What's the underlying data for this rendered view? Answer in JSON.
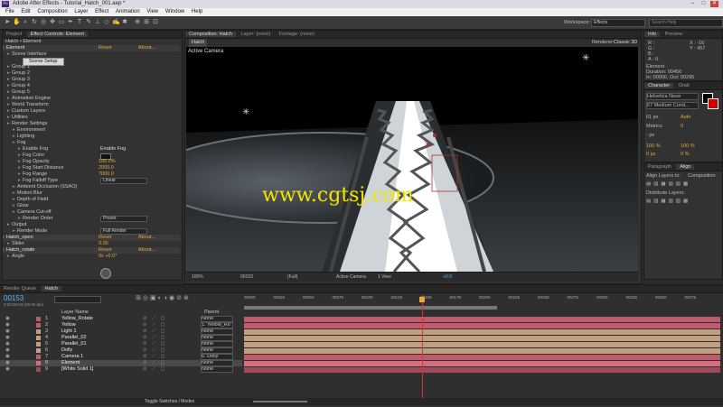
{
  "window": {
    "title": "Adobe After Effects - Tutorial_Hatch_001.aep *"
  },
  "menu": [
    "File",
    "Edit",
    "Composition",
    "Layer",
    "Effect",
    "Animation",
    "View",
    "Window",
    "Help"
  ],
  "workspace": {
    "label": "Workspace:",
    "value": "Effects",
    "search_placeholder": "Search Help"
  },
  "left_panel": {
    "tabs": [
      "Project",
      "Effect Controls: Element"
    ],
    "breadcrumb": "Hatch • Element",
    "rows": [
      {
        "indent": 0,
        "text": "Element",
        "value": "Reset",
        "extra": "About...",
        "kind": "header"
      },
      {
        "indent": 1,
        "text": "Scene Interface"
      },
      {
        "indent": 3,
        "text": "Scene Setup",
        "kind": "button"
      },
      {
        "indent": 1,
        "text": "Group 1"
      },
      {
        "indent": 1,
        "text": "Group 2"
      },
      {
        "indent": 1,
        "text": "Group 3"
      },
      {
        "indent": 1,
        "text": "Group 4"
      },
      {
        "indent": 1,
        "text": "Group 5"
      },
      {
        "indent": 1,
        "text": "Animation Engine"
      },
      {
        "indent": 1,
        "text": "World Transform"
      },
      {
        "indent": 1,
        "text": "Custom Layers"
      },
      {
        "indent": 1,
        "text": "Utilities"
      },
      {
        "indent": 1,
        "text": "Render Settings"
      },
      {
        "indent": 2,
        "text": "Environment"
      },
      {
        "indent": 2,
        "text": "Lighting"
      },
      {
        "indent": 2,
        "text": "Fog"
      },
      {
        "indent": 3,
        "text": "Enable Fog",
        "check": "Enable Fog"
      },
      {
        "indent": 3,
        "text": "Fog Color",
        "kind": "color"
      },
      {
        "indent": 3,
        "text": "Fog Opacity",
        "value": "100.0%"
      },
      {
        "indent": 3,
        "text": "Fog Start Distance",
        "value": "2000.0"
      },
      {
        "indent": 3,
        "text": "Fog Range",
        "value": "7000.0"
      },
      {
        "indent": 3,
        "text": "Fog Falloff Type",
        "dropdown": "Linear"
      },
      {
        "indent": 2,
        "text": "Ambient Occlusion (SSAO)"
      },
      {
        "indent": 2,
        "text": "Motion Blur"
      },
      {
        "indent": 2,
        "text": "Depth of Field"
      },
      {
        "indent": 2,
        "text": "Glow"
      },
      {
        "indent": 2,
        "text": "Camera Cut-off"
      },
      {
        "indent": 3,
        "text": "Render Order",
        "dropdown": "Preset"
      },
      {
        "indent": 1,
        "text": "Output"
      },
      {
        "indent": 2,
        "text": "Render Mode",
        "dropdown": "Full Render"
      },
      {
        "indent": 0,
        "text": "Hatch_open",
        "value": "Reset",
        "extra": "About...",
        "kind": "header"
      },
      {
        "indent": 1,
        "text": "Slider",
        "value": "0.00"
      },
      {
        "indent": 0,
        "text": "Hatch_rotate",
        "value": "Reset",
        "extra": "About...",
        "kind": "header"
      },
      {
        "indent": 1,
        "text": "Angle",
        "value": "0x +0.0°"
      }
    ]
  },
  "comp_panel": {
    "tabs": [
      "Composition: Hatch",
      "Layer: (none)",
      "Footage: (none)"
    ],
    "sub_tab": "Hatch",
    "renderer_label": "Renderer:",
    "renderer_value": "Classic 3D",
    "camera_label": "Active Camera",
    "watermark": "www.cgtsj.com",
    "bottom_bar": {
      "zoom": "100%",
      "timecode": "00153",
      "resolution": "(Full)",
      "view": "Active Camera",
      "views": "1 View",
      "exposure": "+0.0"
    }
  },
  "info_panel": {
    "tabs": [
      "Info",
      "Preview"
    ],
    "r": "R :",
    "g": "G :",
    "b": "B :",
    "a": "A : 0",
    "x": "X : -16",
    "y": "Y : 457",
    "layer_name": "Element",
    "duration": "Duration: 00456",
    "in_out": "In: 00000, Out: 00295"
  },
  "character_panel": {
    "tabs": [
      "Character",
      "Grab"
    ],
    "font": "Helvetica Neue",
    "style": "67 Medium Cond...",
    "size": "61 px",
    "leading": "Auto",
    "tracking_label": "Metrics",
    "tracking": "0",
    "stroke": "- px",
    "vscale": "100 %",
    "hscale": "100 %",
    "baseline": "0 px",
    "tsume": "0 %"
  },
  "align_panel": {
    "tabs": [
      "Paragraph",
      "Align"
    ],
    "align_label": "Align Layers to:",
    "align_value": "Composition",
    "distribute_label": "Distribute Layers:"
  },
  "timeline": {
    "tabs": [
      "Render Queue",
      "Hatch"
    ],
    "timecode": "00153",
    "sub_timecode": "0:00:06:03 (25.00 fps)",
    "search_placeholder": "",
    "col_layer": "Layer Name",
    "col_parent": "Parent",
    "ruler": [
      "00000",
      "00025",
      "00050",
      "00075",
      "00100",
      "00125",
      "00150",
      "00175",
      "00200",
      "00225",
      "00250",
      "00275",
      "00300",
      "00325",
      "00350",
      "00375"
    ],
    "toggle_label": "Toggle Switches / Modes",
    "layers": [
      {
        "num": "1",
        "name": "Yellow_Rotate",
        "parent": "None",
        "color": "#c05a6c"
      },
      {
        "num": "2",
        "name": "Yellow",
        "parent": "1. Yellow_Ro",
        "color": "#c05a6c"
      },
      {
        "num": "3",
        "name": "Light 1",
        "parent": "None",
        "color": "#c0a080"
      },
      {
        "num": "4",
        "name": "Parallel_02",
        "parent": "None",
        "color": "#c0a080"
      },
      {
        "num": "5",
        "name": "Parallel_01",
        "parent": "None",
        "color": "#c0a080"
      },
      {
        "num": "6",
        "name": "Dolly",
        "parent": "None",
        "color": "#c0a080"
      },
      {
        "num": "7",
        "name": "Camera 1",
        "parent": "6. Dolly",
        "color": "#c05a6c"
      },
      {
        "num": "8",
        "name": "Element",
        "parent": "None",
        "color": "#d07080"
      },
      {
        "num": "9",
        "name": "[White Solid 1]",
        "parent": "None",
        "color": "#a04a5c"
      }
    ]
  },
  "colors": {
    "accent": "#e8a73a",
    "playhead": "#e03030",
    "timeline_bar": "#c0a080",
    "selected_bar": "#d07080"
  }
}
